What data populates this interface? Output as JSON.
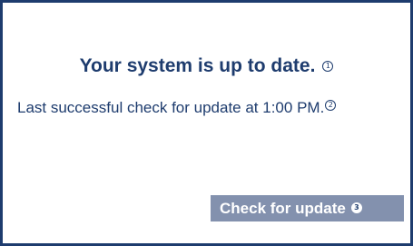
{
  "status": {
    "title": "Your system is up to date.",
    "last_check": "Last successful check for update at 1:00 PM."
  },
  "actions": {
    "check_label": "Check for update"
  },
  "markers": {
    "title": "1",
    "last_check": "2",
    "check_button": "3"
  },
  "colors": {
    "accent": "#1e3c6e",
    "button_background": "#8391ae",
    "button_text": "#ffffff",
    "background": "#ffffff"
  }
}
